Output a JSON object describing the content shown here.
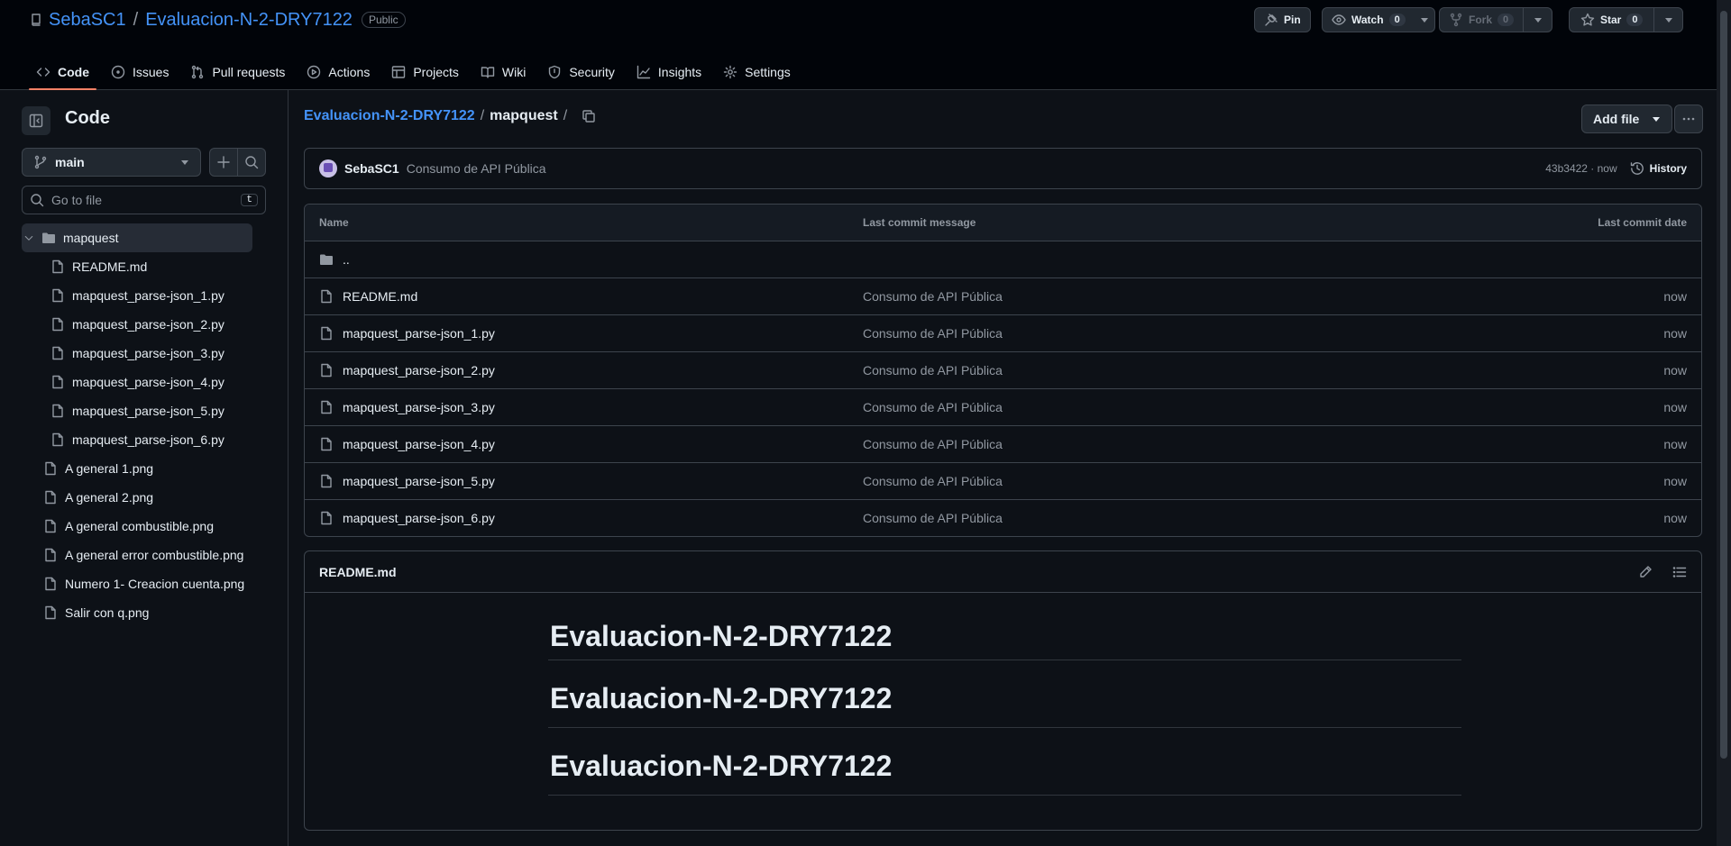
{
  "repo": {
    "owner": "SebaSC1",
    "name": "Evaluacion-N-2-DRY7122",
    "visibility": "Public"
  },
  "header_actions": {
    "pin": "Pin",
    "watch": {
      "label": "Watch",
      "count": "0"
    },
    "fork": {
      "label": "Fork",
      "count": "0"
    },
    "star": {
      "label": "Star",
      "count": "0"
    }
  },
  "nav_tabs": [
    "Code",
    "Issues",
    "Pull requests",
    "Actions",
    "Projects",
    "Wiki",
    "Security",
    "Insights",
    "Settings"
  ],
  "sidebar": {
    "title": "Code",
    "branch": "main",
    "goto_placeholder": "Go to file",
    "goto_shortcut": "t",
    "folder": "mapquest",
    "folder_children": [
      "README.md",
      "mapquest_parse-json_1.py",
      "mapquest_parse-json_2.py",
      "mapquest_parse-json_3.py",
      "mapquest_parse-json_4.py",
      "mapquest_parse-json_5.py",
      "mapquest_parse-json_6.py"
    ],
    "root_files": [
      "A general 1.png",
      "A general 2.png",
      "A general combustible.png",
      "A general error combustible.png",
      "Numero 1- Creacion cuenta.png",
      "Salir con q.png"
    ]
  },
  "breadcrumb": {
    "repo": "Evaluacion-N-2-DRY7122",
    "sep": "/",
    "current": "mapquest",
    "trail": "/"
  },
  "add_file": "Add file",
  "commit": {
    "author": "SebaSC1",
    "message": "Consumo de API Pública",
    "meta": "43b3422 · now",
    "history": "History"
  },
  "file_table": {
    "headers": {
      "name": "Name",
      "message": "Last commit message",
      "date": "Last commit date"
    },
    "parent": "..",
    "rows": [
      {
        "name": "README.md",
        "message": "Consumo de API Pública",
        "date": "now"
      },
      {
        "name": "mapquest_parse-json_1.py",
        "message": "Consumo de API Pública",
        "date": "now"
      },
      {
        "name": "mapquest_parse-json_2.py",
        "message": "Consumo de API Pública",
        "date": "now"
      },
      {
        "name": "mapquest_parse-json_3.py",
        "message": "Consumo de API Pública",
        "date": "now"
      },
      {
        "name": "mapquest_parse-json_4.py",
        "message": "Consumo de API Pública",
        "date": "now"
      },
      {
        "name": "mapquest_parse-json_5.py",
        "message": "Consumo de API Pública",
        "date": "now"
      },
      {
        "name": "mapquest_parse-json_6.py",
        "message": "Consumo de API Pública",
        "date": "now"
      }
    ]
  },
  "readme": {
    "filename": "README.md",
    "headings": [
      "Evaluacion-N-2-DRY7122",
      "Evaluacion-N-2-DRY7122",
      "Evaluacion-N-2-DRY7122"
    ]
  },
  "colors": {
    "accent_link": "#4493f8",
    "tab_underline": "#f78166",
    "background": "#0d1117"
  }
}
